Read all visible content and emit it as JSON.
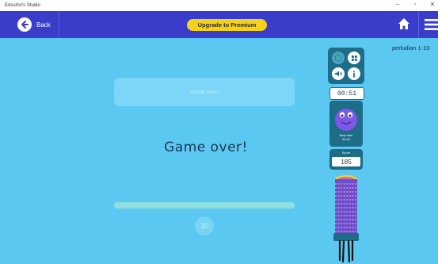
{
  "window": {
    "title": "Edsumo's Studio",
    "controls": [
      "–",
      "▫",
      "✕"
    ]
  },
  "header": {
    "back_label": "Back",
    "premium_label": "Upgrade to Premium"
  },
  "category": "perkalian 1-10",
  "game": {
    "question_text": "Game over!",
    "status_text": "Game over!",
    "countdown": "30",
    "progress": 1.0
  },
  "panel": {
    "timer": "00:51",
    "best_time_label": "Best time",
    "best_time_value": "00:41",
    "score_label": "Score",
    "score_value": "185"
  },
  "colors": {
    "background": "#5bc8f2",
    "header": "#3a3dc9",
    "premium": "#f5d21a",
    "panel": "#1e6d88",
    "monster": "#7e57e8"
  }
}
